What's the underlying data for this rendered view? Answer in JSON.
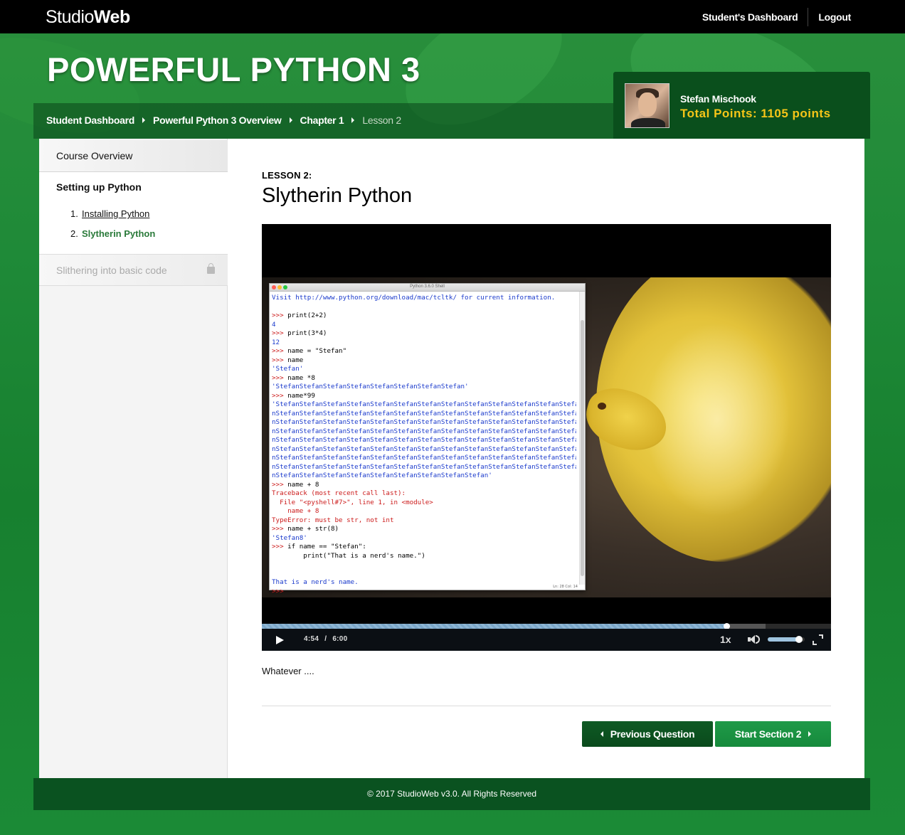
{
  "brand": {
    "studio": "Studio",
    "web": "Web"
  },
  "topnav": {
    "dashboard": "Student's Dashboard",
    "logout": "Logout"
  },
  "course_title": "POWERFUL PYTHON 3",
  "breadcrumbs": [
    {
      "label": "Student Dashboard"
    },
    {
      "label": "Powerful Python 3 Overview"
    },
    {
      "label": "Chapter 1"
    },
    {
      "label": "Lesson 2"
    }
  ],
  "user": {
    "name": "Stefan Mischook",
    "points_label": "Total Points:",
    "points_value": "1105 points"
  },
  "sidebar": {
    "overview": "Course Overview",
    "section_title": "Setting up Python",
    "lessons": [
      {
        "num": "1.",
        "label": "Installing Python"
      },
      {
        "num": "2.",
        "label": "Slytherin Python"
      }
    ],
    "locked_section": "Slithering into basic code"
  },
  "lesson": {
    "label": "LESSON 2:",
    "title": "Slytherin Python"
  },
  "video": {
    "shell_title": "Python 3.6.0 Shell",
    "shell_status": "Ln: 28  Col: 14",
    "current_time": "4:54",
    "separator": "/",
    "duration": "6:00",
    "progress": 0.8167,
    "buffered": 0.885,
    "speed": "1x",
    "volume": 0.85
  },
  "shell_lines": [
    {
      "t": "Visit http://www.python.org/download/mac/tcltk/ for current information.",
      "c": "c-blue"
    },
    {
      "t": "",
      "c": ""
    },
    {
      "t": ">>> print(2+2)",
      "c": "prompt"
    },
    {
      "t": "4",
      "c": "c-blue"
    },
    {
      "t": ">>> print(3*4)",
      "c": "prompt"
    },
    {
      "t": "12",
      "c": "c-blue"
    },
    {
      "t": ">>> name = \"Stefan\"",
      "c": "prompt"
    },
    {
      "t": ">>> name",
      "c": "prompt"
    },
    {
      "t": "'Stefan'",
      "c": "c-blue"
    },
    {
      "t": ">>> name *8",
      "c": "prompt"
    },
    {
      "t": "'StefanStefanStefanStefanStefanStefanStefanStefan'",
      "c": "c-blue"
    },
    {
      "t": ">>> name*99",
      "c": "prompt"
    },
    {
      "t": "'StefanStefanStefanStefanStefanStefanStefanStefanStefanStefanStefanStefanStefa",
      "c": "c-blue"
    },
    {
      "t": "nStefanStefanStefanStefanStefanStefanStefanStefanStefanStefanStefanStefanStefa",
      "c": "c-blue"
    },
    {
      "t": "nStefanStefanStefanStefanStefanStefanStefanStefanStefanStefanStefanStefanStefa",
      "c": "c-blue"
    },
    {
      "t": "nStefanStefanStefanStefanStefanStefanStefanStefanStefanStefanStefanStefanStefa",
      "c": "c-blue"
    },
    {
      "t": "nStefanStefanStefanStefanStefanStefanStefanStefanStefanStefanStefanStefanStefa",
      "c": "c-blue"
    },
    {
      "t": "nStefanStefanStefanStefanStefanStefanStefanStefanStefanStefanStefanStefanStefa",
      "c": "c-blue"
    },
    {
      "t": "nStefanStefanStefanStefanStefanStefanStefanStefanStefanStefanStefanStefanStefa",
      "c": "c-blue"
    },
    {
      "t": "nStefanStefanStefanStefanStefanStefanStefanStefanStefanStefanStefanStefanStefa",
      "c": "c-blue"
    },
    {
      "t": "nStefanStefanStefanStefanStefanStefanStefanStefanStefan'",
      "c": "c-blue"
    },
    {
      "t": ">>> name + 8",
      "c": "prompt"
    },
    {
      "t": "Traceback (most recent call last):",
      "c": "c-red"
    },
    {
      "t": "  File \"<pyshell#7>\", line 1, in <module>",
      "c": "c-red"
    },
    {
      "t": "    name + 8",
      "c": "c-red"
    },
    {
      "t": "TypeError: must be str, not int",
      "c": "c-red"
    },
    {
      "t": ">>> name + str(8)",
      "c": "prompt"
    },
    {
      "t": "'Stefan8'",
      "c": "c-blue"
    },
    {
      "t": ">>> if name == \"Stefan\":",
      "c": "prompt"
    },
    {
      "t": "        print(\"That is a nerd's name.\")",
      "c": ""
    },
    {
      "t": "",
      "c": ""
    },
    {
      "t": "",
      "c": ""
    },
    {
      "t": "That is a nerd's name.",
      "c": "c-blue"
    },
    {
      "t": ">>>",
      "c": "prompt"
    }
  ],
  "description": "Whatever ....",
  "buttons": {
    "previous": "Previous Question",
    "next": "Start Section 2"
  },
  "footer": "© 2017 StudioWeb v3.0. All Rights Reserved",
  "colors": {
    "brand_green": "#0a5220",
    "active_link": "#2a7a3a",
    "points": "#f5c518"
  }
}
